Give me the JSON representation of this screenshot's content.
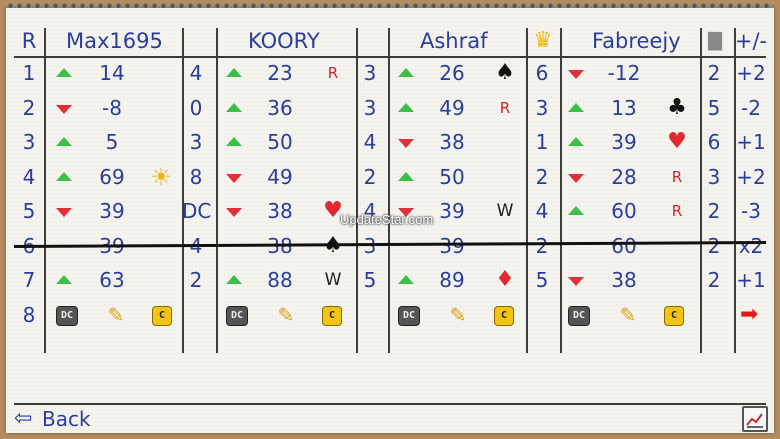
{
  "header": {
    "round": "R",
    "players": [
      "Max1695",
      "KOORY",
      "Ashraf",
      "Fabreejy"
    ],
    "plusminus": "+/-"
  },
  "rounds": [
    {
      "r": "1",
      "bids": [
        "4",
        "3",
        "6",
        "2"
      ],
      "scores": [
        "14",
        "23",
        "26",
        "-12"
      ],
      "dirs": [
        "up",
        "up",
        "up",
        "down"
      ],
      "syms": [
        "",
        "R",
        "spade",
        ""
      ],
      "pm": "+2"
    },
    {
      "r": "2",
      "bids": [
        "0",
        "3",
        "3",
        "5"
      ],
      "scores": [
        "-8",
        "36",
        "49",
        "13"
      ],
      "dirs": [
        "down",
        "up",
        "up",
        "up"
      ],
      "syms": [
        "",
        "",
        "R",
        "club"
      ],
      "pm": "-2"
    },
    {
      "r": "3",
      "bids": [
        "3",
        "4",
        "1",
        "6"
      ],
      "scores": [
        "5",
        "50",
        "38",
        "39"
      ],
      "dirs": [
        "up",
        "up",
        "down",
        "up"
      ],
      "syms": [
        "",
        "",
        "",
        "heart"
      ],
      "pm": "+1"
    },
    {
      "r": "4",
      "bids": [
        "8",
        "2",
        "2",
        "3"
      ],
      "scores": [
        "69",
        "49",
        "50",
        "28"
      ],
      "dirs": [
        "up",
        "down",
        "up",
        "down"
      ],
      "syms": [
        "sun",
        "",
        "",
        "R"
      ],
      "pm": "+2"
    },
    {
      "r": "5",
      "bids": [
        "DC",
        "4",
        "4",
        "2"
      ],
      "scores": [
        "39",
        "38",
        "39",
        "60"
      ],
      "dirs": [
        "down",
        "down",
        "down",
        "up"
      ],
      "syms": [
        "",
        "heart",
        "W",
        "R"
      ],
      "pm": "-3"
    },
    {
      "r": "6",
      "bids": [
        "4",
        "3",
        "2",
        "2"
      ],
      "scores": [
        "39",
        "38",
        "39",
        "60"
      ],
      "dirs": [
        "",
        "",
        "",
        ""
      ],
      "syms": [
        "",
        "spade",
        "",
        ""
      ],
      "pm": "x2"
    },
    {
      "r": "7",
      "bids": [
        "2",
        "5",
        "5",
        "2"
      ],
      "scores": [
        "63",
        "88",
        "89",
        "38"
      ],
      "dirs": [
        "up",
        "up",
        "up",
        "down"
      ],
      "syms": [
        "",
        "W",
        "diamond",
        ""
      ],
      "pm": "+1"
    }
  ],
  "round8": "8",
  "controls": {
    "dc": "DC",
    "c": "C"
  },
  "footer": {
    "back_label": "Back",
    "watermark": "UpdateStar.com"
  },
  "colors": {
    "ink": "#2a3d9a",
    "up": "#3cc04a",
    "down": "#e0303a",
    "accent": "#f3c413"
  }
}
